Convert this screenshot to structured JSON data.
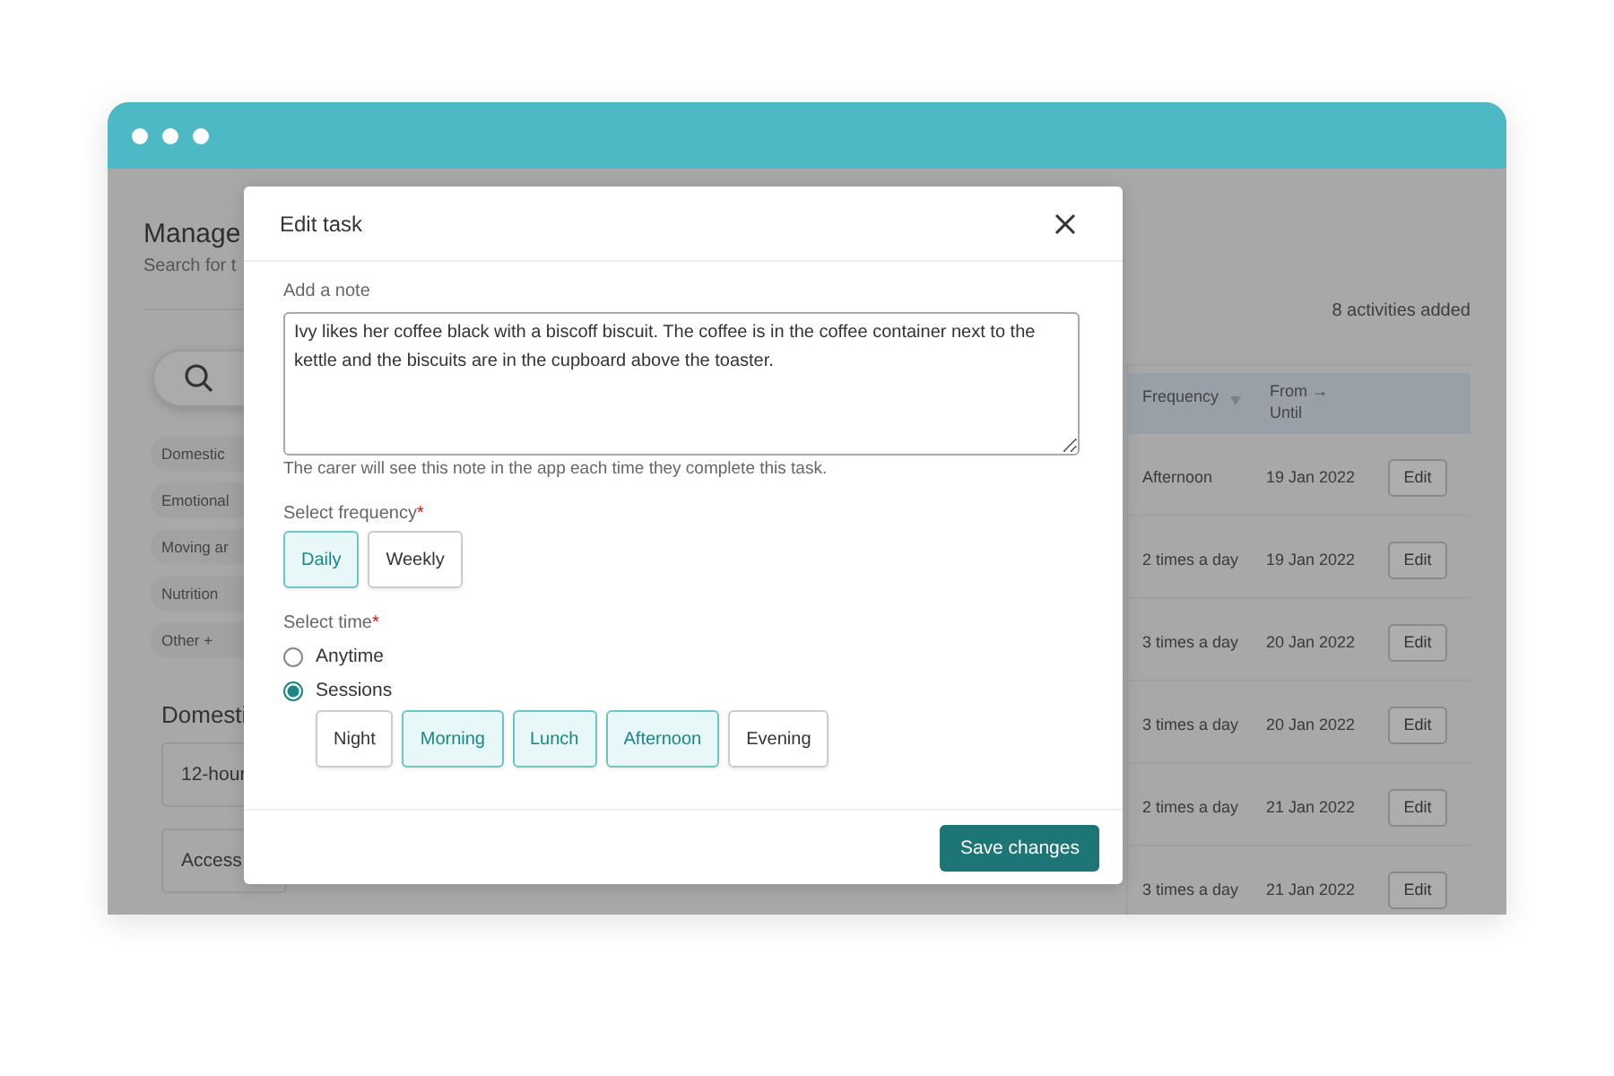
{
  "page": {
    "title": "Manage",
    "subtitle": "Search for t",
    "categories": [
      {
        "label": "Domestic"
      },
      {
        "label": "Emotional"
      },
      {
        "label": "Moving ar"
      },
      {
        "label": "Nutrition"
      },
      {
        "label": "Other  +"
      }
    ],
    "section_title": "Domesti",
    "tasks": [
      {
        "label": "12-hour"
      },
      {
        "label": "Access"
      }
    ],
    "activity_count": "8 activities added"
  },
  "table": {
    "columns": [
      {
        "label": "Frequency",
        "sortable": true
      },
      {
        "label": "From →\nUntil"
      }
    ],
    "rows": [
      {
        "frequency": "Afternoon",
        "from": "19 Jan 2022",
        "action": "Edit"
      },
      {
        "frequency": "2 times a day",
        "from": "19 Jan 2022",
        "action": "Edit"
      },
      {
        "frequency": "3 times a day",
        "from": "20 Jan 2022",
        "action": "Edit"
      },
      {
        "frequency": "3 times a day",
        "from": "20 Jan 2022",
        "action": "Edit"
      },
      {
        "frequency": "2 times a day",
        "from": "21 Jan 2022",
        "action": "Edit"
      },
      {
        "frequency": "3 times a day",
        "from": "21 Jan 2022",
        "action": "Edit"
      }
    ]
  },
  "modal": {
    "title": "Edit task",
    "note_label": "Add a note",
    "note": "Ivy likes her coffee black with a biscoff biscuit. The coffee is in the coffee container next to the kettle and the biscuits are in the cupboard above the toaster.",
    "note_hint": "The carer will see this note in the app each time they complete this task.",
    "frequency": {
      "label": "Select frequency",
      "mark": "*",
      "options": [
        {
          "label": "Daily",
          "selected": true
        },
        {
          "label": "Weekly",
          "selected": false
        }
      ]
    },
    "time": {
      "label": "Select time",
      "mark": "*",
      "modes": [
        {
          "label": "Anytime",
          "selected": false
        },
        {
          "label": "Sessions",
          "selected": true
        }
      ],
      "sessions": [
        {
          "label": "Night",
          "selected": false
        },
        {
          "label": "Morning",
          "selected": true
        },
        {
          "label": "Lunch",
          "selected": true
        },
        {
          "label": "Afternoon",
          "selected": true
        },
        {
          "label": "Evening",
          "selected": false
        }
      ]
    },
    "save": "Save changes"
  }
}
